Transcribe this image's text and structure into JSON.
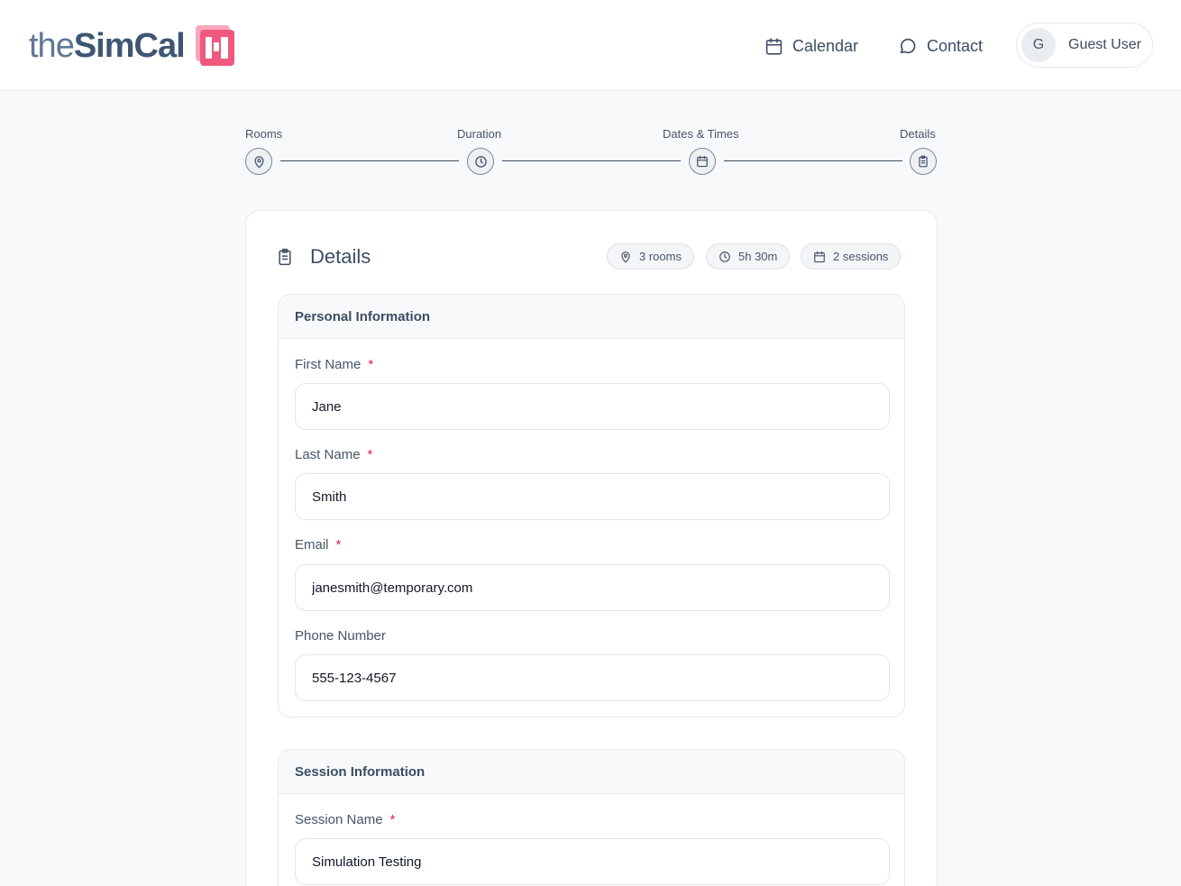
{
  "header": {
    "logo": {
      "the": "the",
      "brand": "SimCal"
    },
    "nav": {
      "calendar": "Calendar",
      "contact": "Contact"
    },
    "user": {
      "initial": "G",
      "name": "Guest User"
    }
  },
  "stepper": {
    "steps": [
      "Rooms",
      "Duration",
      "Dates & Times",
      "Details"
    ]
  },
  "card": {
    "title": "Details",
    "chips": {
      "rooms": "3 rooms",
      "duration": "5h 30m",
      "sessions": "2 sessions"
    }
  },
  "personal": {
    "heading": "Personal Information",
    "first_name": {
      "label": "First Name",
      "value": "Jane",
      "required": "*"
    },
    "last_name": {
      "label": "Last Name",
      "value": "Smith",
      "required": "*"
    },
    "email": {
      "label": "Email",
      "value": "janesmith@temporary.com",
      "required": "*"
    },
    "phone": {
      "label": "Phone Number",
      "value": "555-123-4567"
    }
  },
  "session": {
    "heading": "Session Information",
    "session_name": {
      "label": "Session Name",
      "value": "Simulation Testing",
      "required": "*"
    }
  },
  "colors": {
    "brand_dark": "#3e5673",
    "brand_pink": "#f0587e",
    "required": "#e11d48",
    "text": "#3b4d63",
    "background": "#f8f9fb"
  }
}
